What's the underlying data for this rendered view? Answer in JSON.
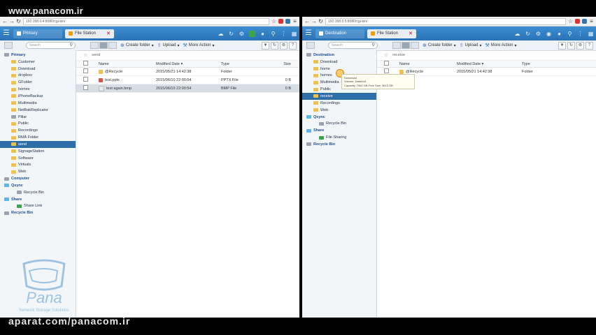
{
  "watermark": {
    "top": "www.panacom.ir",
    "bottom": "aparat.com/panacom.ir"
  },
  "left": {
    "url": "192.168.0.4:8080/cgi-bin/",
    "tabs": [
      {
        "label": "Primary"
      },
      {
        "label": "File Station"
      }
    ],
    "toolbar": {
      "search_placeholder": "Search",
      "create_folder": "Create folder",
      "upload": "Upload",
      "more_action": "More Action"
    },
    "tree": {
      "root": "Primary",
      "items": [
        "Customer",
        "Download",
        "dropbox",
        "GFolder",
        "homes",
        "iPhoneBackup",
        "Multimedia",
        "NetBakReplicator",
        "Pillar",
        "Public",
        "Recordings",
        "RMA Folder",
        "send",
        "SignageStation",
        "Software",
        "Virtuals",
        "Web"
      ],
      "selected": "send",
      "computer": "Computer",
      "qsync": "Qsync",
      "qsync_items": [
        "Recycle Bin"
      ],
      "share": "Share",
      "share_items": [
        "Share Link"
      ],
      "recycle": "Recycle Bin"
    },
    "breadcrumb": "send",
    "columns": {
      "name": "Name",
      "modified": "Modified Date",
      "type": "Type",
      "size": "Size"
    },
    "files": [
      {
        "name": "@Recycle",
        "modified": "2015/05/21 14:42:38",
        "type": "Folder",
        "size": "",
        "icon_color": "#f0c04a"
      },
      {
        "name": "test.pptx",
        "modified": "2015/06/10 22:00:54",
        "type": "PPTX File",
        "size": "0 B",
        "icon_color": "#d9534f"
      },
      {
        "name": "test again.bmp",
        "modified": "2015/06/10 22:00:54",
        "type": "BMP File",
        "size": "0 B",
        "icon_color": "#e6e6e6"
      }
    ]
  },
  "right": {
    "url": "192.168.0.5:8080/cgi-bin/",
    "tabs": [
      {
        "label": "Destination"
      },
      {
        "label": "File Station"
      }
    ],
    "toolbar": {
      "search_placeholder": "Search",
      "create_folder": "Create folder",
      "upload": "Upload",
      "more_action": "More Action"
    },
    "tree": {
      "root": "Destination",
      "items": [
        "Download",
        "home",
        "homes",
        "Multimedia",
        "Public",
        "receive",
        "Recordings",
        "Web"
      ],
      "selected": "receive",
      "qsync": "Qsync",
      "qsync_items": [
        "Recycle Bin"
      ],
      "share": "Share",
      "share_items": [
        "File Sharing"
      ],
      "recycle": "Recycle Bin"
    },
    "breadcrumb": "receive",
    "columns": {
      "name": "Name",
      "modified": "Modified Date",
      "type": "Type"
    },
    "files": [
      {
        "name": "@Recycle",
        "modified": "2015/05/21 14:42:38",
        "type": "Folder",
        "icon_color": "#f0c04a"
      }
    ],
    "tooltip": {
      "line1": "Download",
      "line2": "Volume: DataVol1",
      "line3": "Capacity: 7982 GB Free Size: 3613 GB"
    }
  },
  "logo": {
    "caption": "Network Storage Solutions"
  }
}
